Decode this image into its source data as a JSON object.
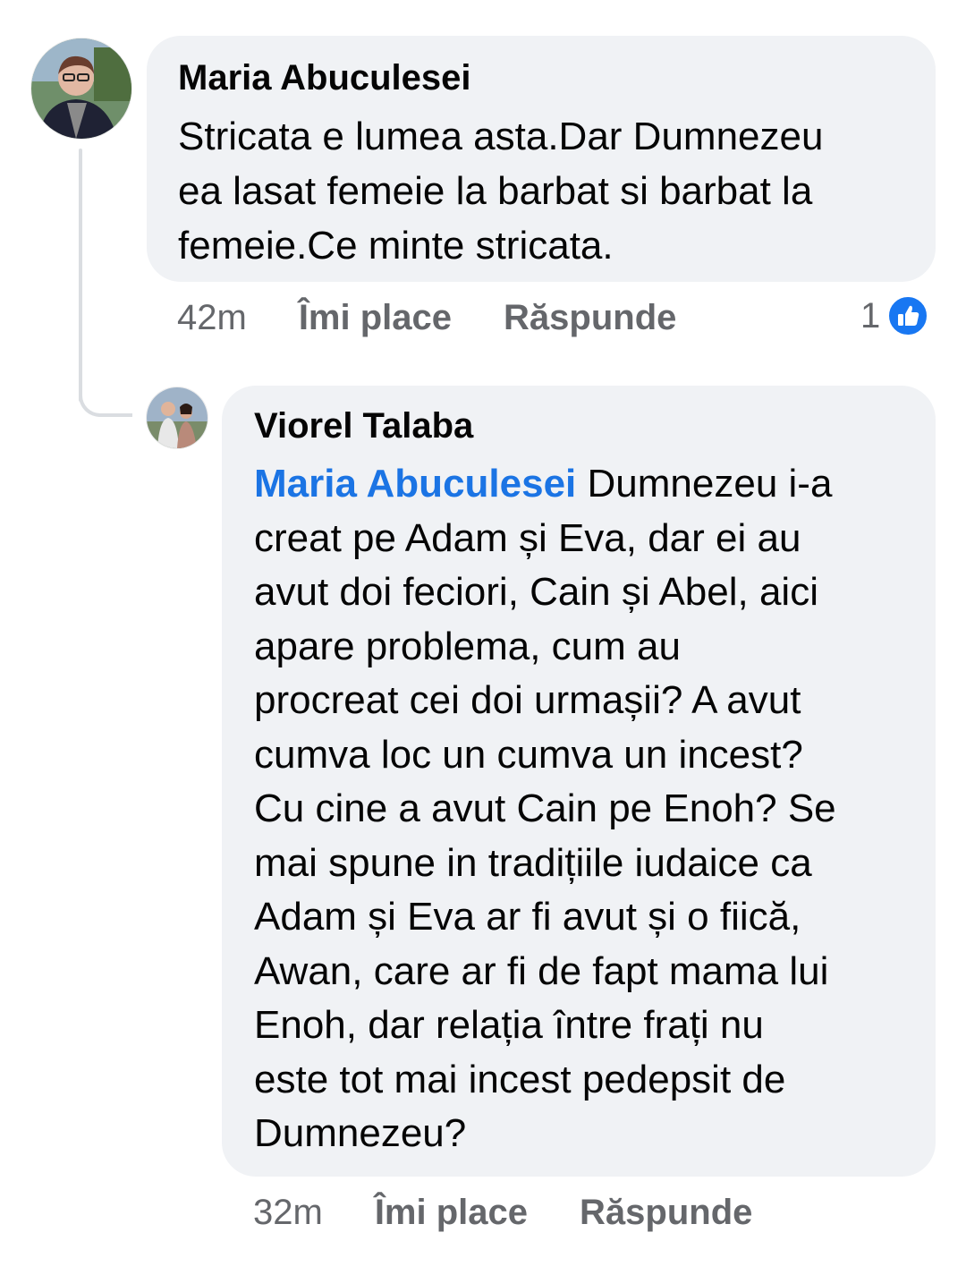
{
  "comments": [
    {
      "author": "Maria Abuculesei",
      "text": "Stricata e lumea asta.Dar Dumnezeu\nea lasat femeie la barbat si barbat la\nfemeie.Ce minte stricata.",
      "time": "42m",
      "like_label": "Îmi place",
      "reply_label": "Răspunde",
      "reaction_count": "1",
      "reaction_icon": "like-icon"
    },
    {
      "author": "Viorel Talaba",
      "mention": "Maria Abuculesei",
      "text": " Dumnezeu i-a\ncreat pe Adam și Eva, dar ei au\navut doi feciori, Cain și Abel, aici\napare problema, cum au\nprocreat cei doi urmașii? A avut\ncumva loc un cumva un incest?\nCu cine a avut Cain pe Enoh? Se\nmai spune in tradițiile iudaice ca\nAdam și Eva ar fi avut și o fiică,\nAwan, care ar fi de fapt mama lui\nEnoh, dar relația între frați nu\neste tot mai incest pedepsit de\nDumnezeu?",
      "time": "32m",
      "like_label": "Îmi place",
      "reply_label": "Răspunde"
    }
  ],
  "colors": {
    "bubble": "#f0f2f5",
    "secondary_text": "#65676b",
    "mention": "#1b74e4",
    "like_blue": "#1877f2",
    "thread_line": "#dadde1"
  }
}
